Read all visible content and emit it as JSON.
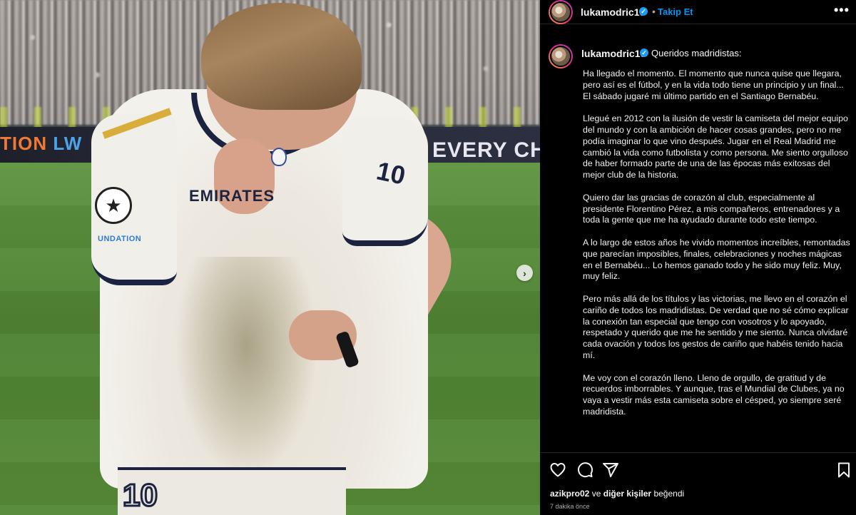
{
  "media": {
    "ad_left_orange": "TION",
    "ad_left_blue": "LW",
    "ad_right": "USE EVERY CH",
    "sponsor": "EMIRATES",
    "sleeve_number": "10",
    "shorts_number": "10",
    "patch_text": "UNDATION",
    "next_icon": "chevron-right-icon"
  },
  "post": {
    "username": "lukamodric10",
    "verified_icon": "✓",
    "separator": "•",
    "follow_label": "Takip Et",
    "more_icon": "•••",
    "caption_greeting": "Queridos madridistas:",
    "paragraphs": [
      "Ha llegado el momento. El momento que nunca quise que llegara, pero así es el fútbol, y en la vida todo tiene un principio y un final... El sábado jugaré mi último partido en el Santiago Bernabéu.",
      "Llegué en 2012 con la ilusión de vestir la camiseta del mejor equipo del mundo y con la ambición de hacer cosas grandes, pero no me podía imaginar lo que vino después. Jugar en el Real Madrid me cambió la vida como futbolista y como persona. Me siento orgulloso de haber formado parte de una de las épocas más exitosas del mejor club de la historia.",
      "Quiero dar las gracias de corazón al club, especialmente al presidente Florentino Pérez, a mis compañeros, entrenadores y a toda la gente que me ha ayudado durante todo este tiempo.",
      "A lo largo de estos años he vivido momentos increíbles, remontadas que parecían imposibles, finales, celebraciones y noches mágicas en el Bernabéu... Lo hemos ganado todo y he sido muy feliz. Muy, muy feliz.",
      "Pero más allá de los títulos y las victorias, me llevo en el corazón el cariño de todos los madridistas. De verdad que no sé cómo explicar la conexión tan especial que tengo con vosotros y lo apoyado, respetado y querido que me he sentido y me siento. Nunca olvidaré cada ovación y todos los gestos de cariño que habéis tenido hacia mí.",
      "Me voy con el corazón lleno. Lleno de orgullo, de gratitud y de recuerdos imborrables. Y aunque, tras el Mundial de Clubes, ya no vaya a vestir más esta camiseta sobre el césped, yo siempre seré madridista."
    ],
    "likes": {
      "user": "azikpro02",
      "connector": "ve",
      "others": "diğer kişiler",
      "verb": "beğendi"
    },
    "time_ago": "7 dakika önce",
    "icons": [
      "heart-icon",
      "comment-icon",
      "share-icon",
      "bookmark-icon"
    ]
  }
}
